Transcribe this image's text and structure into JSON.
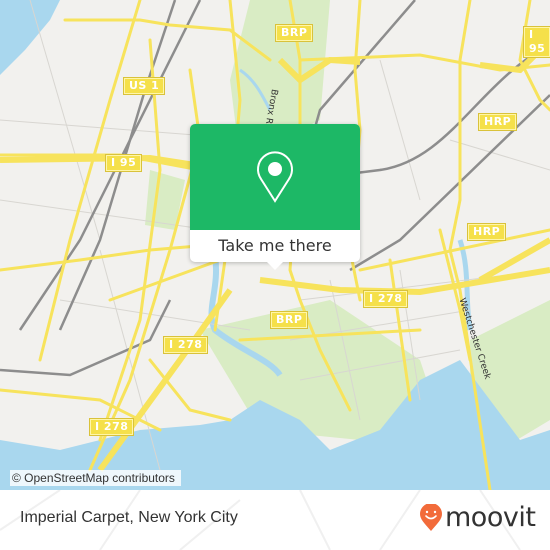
{
  "map": {
    "colors": {
      "background": "#f2f1ee",
      "road": "#f7e35c",
      "water": "#a9d7ee",
      "park": "#d9ecc4",
      "rail": "#8d8d8d",
      "accent": "#1db866"
    },
    "road_shields": [
      {
        "label": "US 1",
        "name": "shield-us1"
      },
      {
        "label": "I 95",
        "name": "shield-i95-west"
      },
      {
        "label": "BRP",
        "name": "shield-brp-north"
      },
      {
        "label": "I 95",
        "name": "shield-i95-east"
      },
      {
        "label": "HRP",
        "name": "shield-hrp-north"
      },
      {
        "label": "HRP",
        "name": "shield-hrp-south"
      },
      {
        "label": "BRP",
        "name": "shield-brp-south"
      },
      {
        "label": "I 278",
        "name": "shield-i278-east"
      },
      {
        "label": "I 278",
        "name": "shield-i278-mid"
      },
      {
        "label": "I 278",
        "name": "shield-i278-west"
      }
    ],
    "water_labels": {
      "bronx_river": "Bronx River",
      "westchester_creek": "Westchester Creek"
    },
    "attribution": "© OpenStreetMap contributors"
  },
  "popup": {
    "icon": "location-pin-icon",
    "cta_label": "Take me there"
  },
  "footer": {
    "place_name": "Imperial Carpet, New York City",
    "brand": "moovit",
    "brand_color": "#f26b3a"
  }
}
